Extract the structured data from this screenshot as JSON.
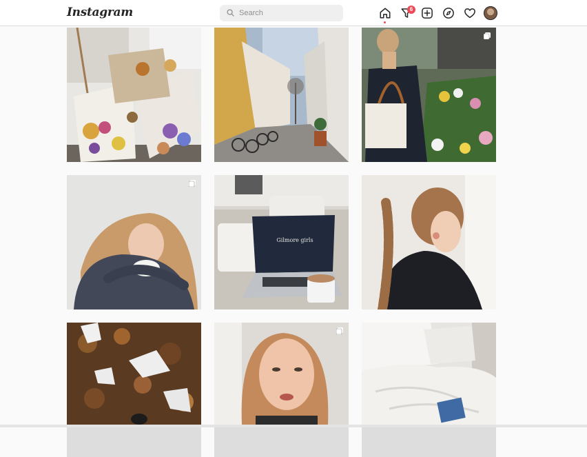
{
  "app": {
    "logo_text": "Instagram"
  },
  "search": {
    "placeholder": "Search",
    "value": ""
  },
  "nav": {
    "icons": [
      "home-icon",
      "direct-filter-icon",
      "new-post-icon",
      "explore-icon",
      "activity-heart-icon",
      "profile-avatar"
    ],
    "notification_count": "6"
  },
  "colors": {
    "badge": "#ed4956",
    "text": "#262626",
    "page_bg": "#fafafa"
  },
  "grid": {
    "posts": [
      {
        "subject": "dried flower bouquets",
        "multi": false
      },
      {
        "subject": "old town street with bicycles",
        "multi": false
      },
      {
        "subject": "person with tote bag at flower market",
        "multi": true
      },
      {
        "subject": "girl hugging knees in grey sweater",
        "multi": true
      },
      {
        "subject": "laptop showing Gilmore girls on bed with coffee",
        "multi": false,
        "screen_text": "Gilmore girls"
      },
      {
        "subject": "braided hair profile",
        "multi": false
      },
      {
        "subject": "autumn leaves with snow",
        "multi": false
      },
      {
        "subject": "red-haired girl portrait",
        "multi": true
      },
      {
        "subject": "white bedding with book",
        "multi": false
      }
    ]
  }
}
